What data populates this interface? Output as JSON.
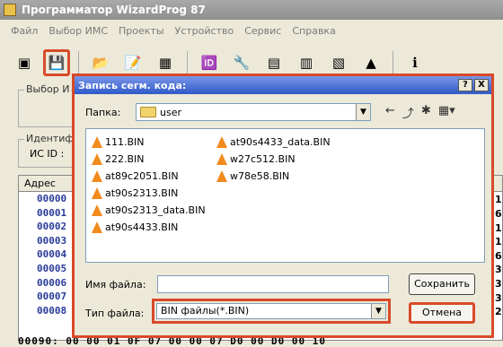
{
  "app": {
    "title": "Программатор WizardProg 87"
  },
  "menu": [
    "Файл",
    "Выбор ИМС",
    "Проекты",
    "Устройство",
    "Сервис",
    "Справка"
  ],
  "toolbar": {
    "buttons": [
      {
        "name": "open-icon",
        "glyph": "▣"
      },
      {
        "name": "save-icon",
        "glyph": "💾"
      },
      {
        "name": "load-icon",
        "glyph": "📂"
      },
      {
        "name": "edit-icon",
        "glyph": "📝"
      },
      {
        "name": "calc-icon",
        "glyph": "▦"
      },
      {
        "name": "id-icon",
        "glyph": "🆔"
      },
      {
        "name": "prog-icon",
        "glyph": "🔧"
      },
      {
        "name": "chip-icon",
        "glyph": "▤"
      },
      {
        "name": "read-icon",
        "glyph": "▥"
      },
      {
        "name": "verify-icon",
        "glyph": "▧"
      },
      {
        "name": "write-icon",
        "glyph": "▲"
      },
      {
        "name": "info-icon",
        "glyph": "ℹ"
      }
    ]
  },
  "main": {
    "chip_group_label": "Выбор И",
    "ident_group_label": "Идентиф",
    "ic_id_label": "ИС ID :",
    "address_header": "Адрес",
    "addresses": [
      "00000",
      "00001",
      "00002",
      "00003",
      "00004",
      "00005",
      "00006",
      "00007",
      "00008"
    ],
    "right_digits": [
      "1",
      "6",
      "1",
      "1",
      "6",
      "3",
      "3",
      "3",
      "2"
    ],
    "bottom_row": "00090:  00  00  01  0F  07  00  00  07  D0  00  D0  00  10"
  },
  "dialog": {
    "title": "Запись сегм. кода:",
    "help_btn": "?",
    "close_btn": "X",
    "folder_label": "Папка:",
    "folder_value": "user",
    "files_col1": [
      "111.BIN",
      "222.BIN",
      "at89c2051.BIN",
      "at90s2313.BIN",
      "at90s2313_data.BIN",
      "at90s4433.BIN"
    ],
    "files_col2": [
      "at90s4433_data.BIN",
      "w27c512.BIN",
      "w78e58.BIN"
    ],
    "filename_label": "Имя файла:",
    "filename_value": "",
    "filetype_label": "Тип файла:",
    "filetype_value": "BIN файлы(*.BIN)",
    "save_btn": "Сохранить",
    "cancel_btn": "Отмена"
  }
}
